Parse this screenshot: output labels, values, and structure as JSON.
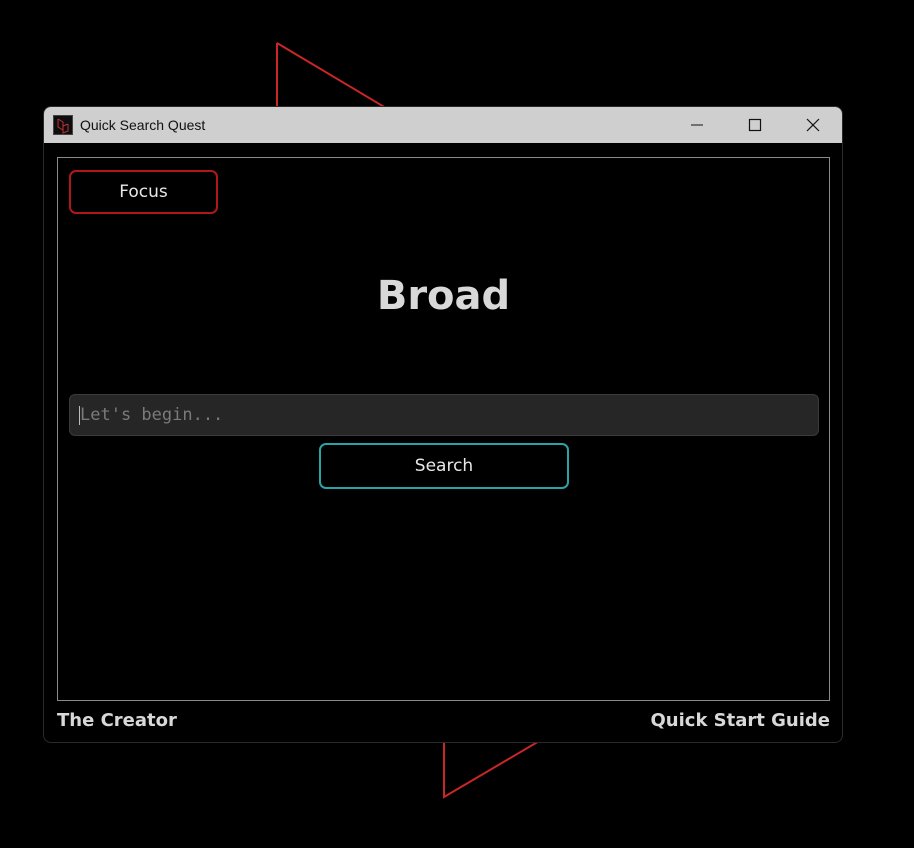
{
  "window": {
    "title": "Quick Search Quest"
  },
  "icons": {
    "app": "app-icon",
    "minimize": "minimize-icon",
    "maximize": "maximize-icon",
    "close": "close-icon"
  },
  "main": {
    "focus_label": "Focus",
    "mode_title": "Broad",
    "search_placeholder": "Let's begin...",
    "search_value": "",
    "search_button_label": "Search"
  },
  "footer": {
    "left_link": "The Creator",
    "right_link": "Quick Start Guide"
  },
  "colors": {
    "background": "#000000",
    "titlebar": "#cfcfcf",
    "focus_border": "#b01818",
    "search_border": "#2aa3a8",
    "decor_line": "#e03030",
    "text": "#d8d8d8"
  }
}
